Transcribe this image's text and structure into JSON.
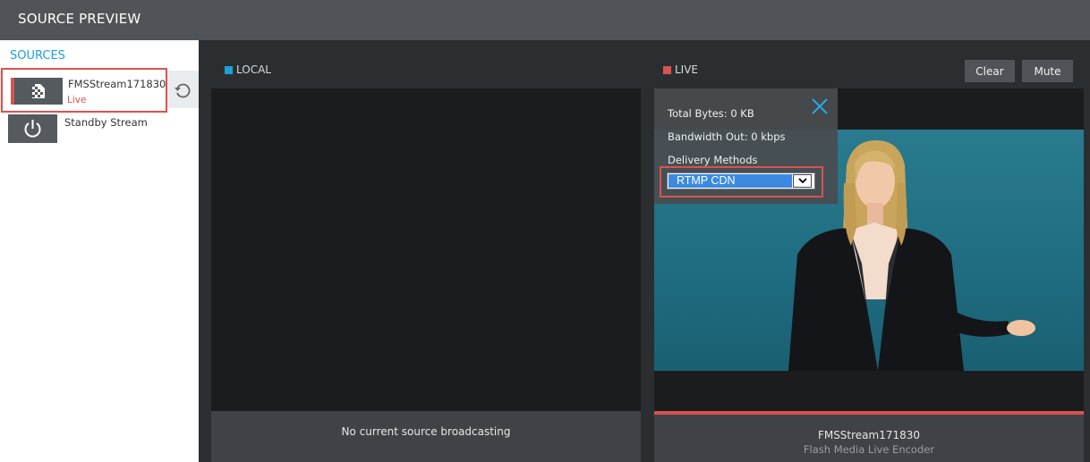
{
  "header": {
    "title": "SOURCE PREVIEW"
  },
  "sidebar": {
    "heading": "SOURCES",
    "sources": [
      {
        "name": "FMSStream171830",
        "status": "Live"
      },
      {
        "name": "Standby Stream"
      }
    ]
  },
  "local_panel": {
    "label": "LOCAL",
    "indicator_color": "#1aa1d6",
    "footer_text": "No current source broadcasting"
  },
  "live_panel": {
    "label": "LIVE",
    "indicator_color": "#d9534f",
    "clear_label": "Clear",
    "mute_label": "Mute",
    "stats": {
      "total_bytes": "Total Bytes: 0 KB",
      "bandwidth_out": "Bandwidth Out: 0 kbps",
      "delivery_methods_label": "Delivery Methods",
      "delivery_method_selected": "RTMP CDN"
    },
    "footer_name": "FMSStream171830",
    "footer_encoder": "Flash Media Live Encoder"
  },
  "icons": {
    "source1_thumb": "encoder-logo-icon",
    "refresh": "refresh-icon",
    "standby": "power-icon",
    "close": "close-icon",
    "dropdown": "chevron-down-icon"
  },
  "colors": {
    "accent_blue": "#1aa1d6",
    "accent_red": "#d9534f"
  }
}
